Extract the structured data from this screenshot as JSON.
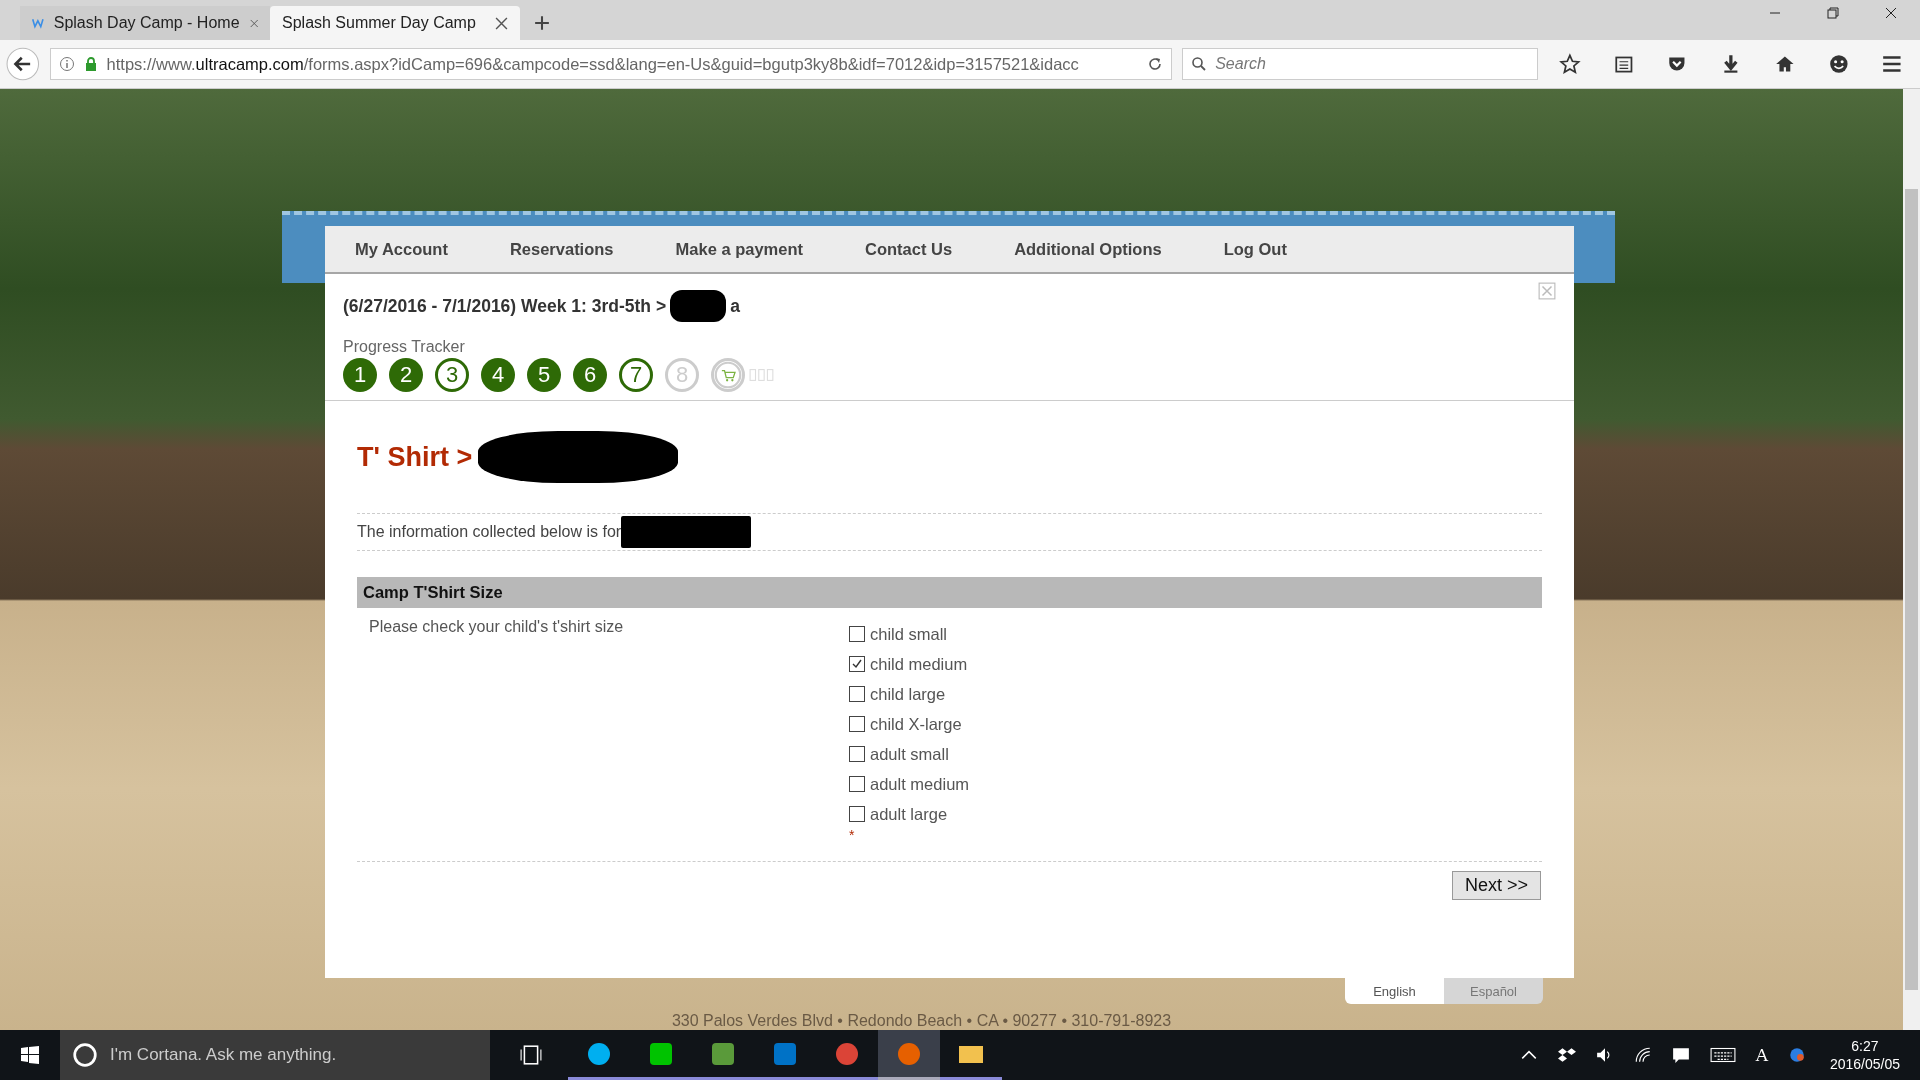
{
  "browser": {
    "tabs": [
      {
        "title": "Splash Day Camp - Home",
        "selected": false
      },
      {
        "title": "Splash Summer Day Camp",
        "selected": true
      }
    ],
    "url": {
      "prefix": "https://www.",
      "domain": "ultracamp.com",
      "rest": "/forms.aspx?idCamp=696&campcode=ssd&lang=en-Us&guid=bgutp3ky8b&idf=7012&idp=3157521&idacc"
    },
    "search": {
      "placeholder": "Search"
    }
  },
  "nav": [
    "My Account",
    "Reservations",
    "Make a payment",
    "Contact Us",
    "Additional Options",
    "Log Out"
  ],
  "session": {
    "heading": "(6/27/2016 - 7/1/2016) Week 1: 3rd-5th >",
    "name_tail": "a"
  },
  "progress": {
    "label": "Progress Tracker",
    "steps": [
      {
        "kind": "number",
        "label": "1",
        "complete": true,
        "locked": false
      },
      {
        "kind": "number",
        "label": "2",
        "complete": true,
        "locked": false
      },
      {
        "kind": "number",
        "label": "3",
        "complete": false,
        "locked": false
      },
      {
        "kind": "number",
        "label": "4",
        "complete": true,
        "locked": false
      },
      {
        "kind": "number",
        "label": "5",
        "complete": true,
        "locked": false
      },
      {
        "kind": "number",
        "label": "6",
        "complete": true,
        "locked": false
      },
      {
        "kind": "number",
        "label": "7",
        "complete": false,
        "locked": false
      },
      {
        "kind": "number",
        "label": "8",
        "complete": false,
        "locked": true
      },
      {
        "kind": "cart",
        "complete": false,
        "locked": true
      }
    ]
  },
  "form": {
    "title": "T' Shirt >",
    "info": "The information collected below is for",
    "section": "Camp T'Shirt Size",
    "question": "Please check your child's t'shirt size",
    "options": [
      {
        "label": "child small",
        "checked": false
      },
      {
        "label": "child medium",
        "checked": true
      },
      {
        "label": "child large",
        "checked": false
      },
      {
        "label": "child X-large",
        "checked": false
      },
      {
        "label": "adult small",
        "checked": false
      },
      {
        "label": "adult medium",
        "checked": false
      },
      {
        "label": "adult large",
        "checked": false
      }
    ],
    "required_mark": "*",
    "next": "Next >>"
  },
  "languages": [
    {
      "label": "English",
      "selected": true
    },
    {
      "label": "Español",
      "selected": false
    }
  ],
  "footer": "330 Palos Verdes Blvd • Redondo Beach • CA • 90277 • 310-791-8923",
  "taskbar": {
    "search": "I'm Cortana. Ask me anything.",
    "apps": [
      {
        "kind": "skype",
        "active": false
      },
      {
        "kind": "line",
        "active": false
      },
      {
        "kind": "evernote",
        "active": false
      },
      {
        "kind": "outlook",
        "active": false
      },
      {
        "kind": "chrome",
        "active": false
      },
      {
        "kind": "firefox",
        "active": true
      },
      {
        "kind": "explorer",
        "active": false
      }
    ],
    "ime": "A",
    "time": "6:27",
    "date": "2016/05/05"
  }
}
